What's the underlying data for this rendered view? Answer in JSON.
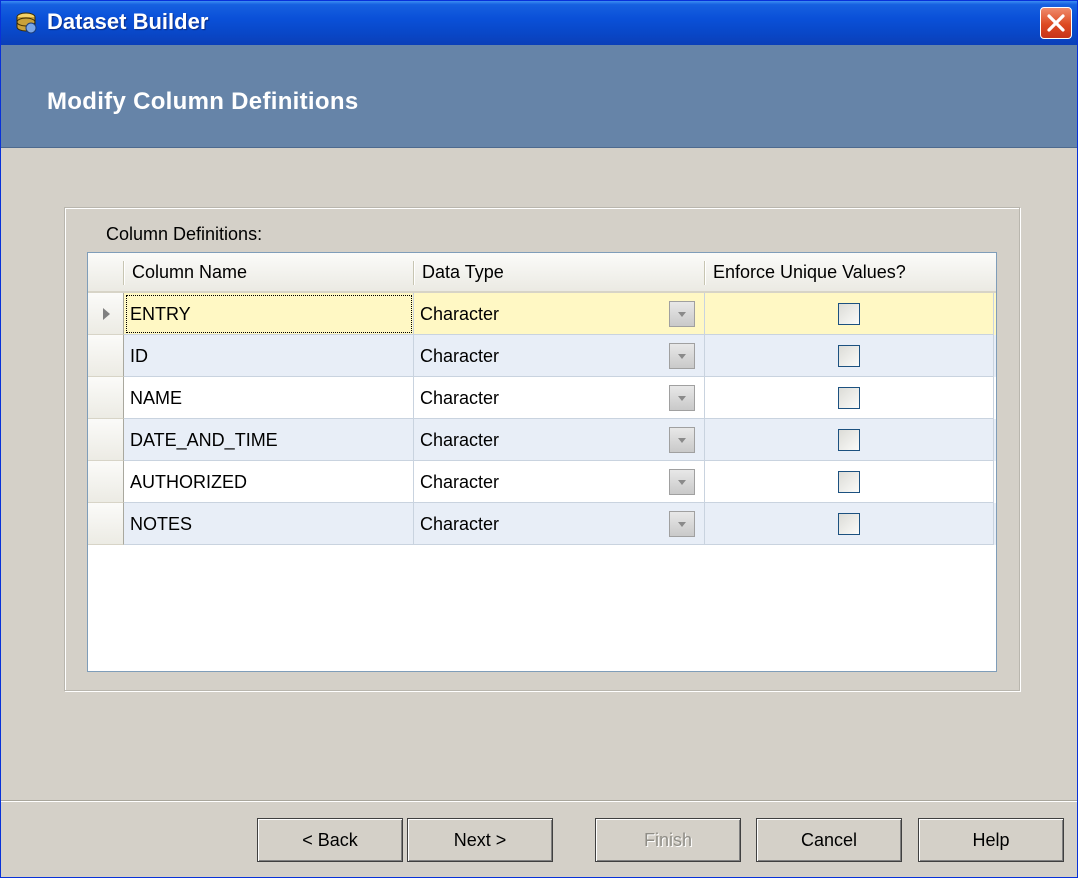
{
  "window": {
    "title": "Dataset Builder",
    "close_icon": "close-icon",
    "app_icon": "dataset-builder-icon"
  },
  "header": {
    "title": "Modify Column Definitions"
  },
  "group": {
    "label": "Column Definitions:"
  },
  "grid": {
    "headers": [
      "Column Name",
      "Data Type",
      "Enforce Unique Values?"
    ],
    "rows": [
      {
        "name": "ENTRY",
        "type": "Character",
        "unique": false,
        "current": true
      },
      {
        "name": "ID",
        "type": "Character",
        "unique": false
      },
      {
        "name": "NAME",
        "type": "Character",
        "unique": false
      },
      {
        "name": "DATE_AND_TIME",
        "type": "Character",
        "unique": false
      },
      {
        "name": "AUTHORIZED",
        "type": "Character",
        "unique": false
      },
      {
        "name": "NOTES",
        "type": "Character",
        "unique": false
      }
    ]
  },
  "buttons": {
    "back": "< Back",
    "next": "Next >",
    "finish": "Finish",
    "cancel": "Cancel",
    "help": "Help"
  },
  "colors": {
    "titlebar": "#0a50d8",
    "header_band": "#6684a8",
    "selected_row": "#fff8c4",
    "alt_row": "#e8eef7"
  }
}
